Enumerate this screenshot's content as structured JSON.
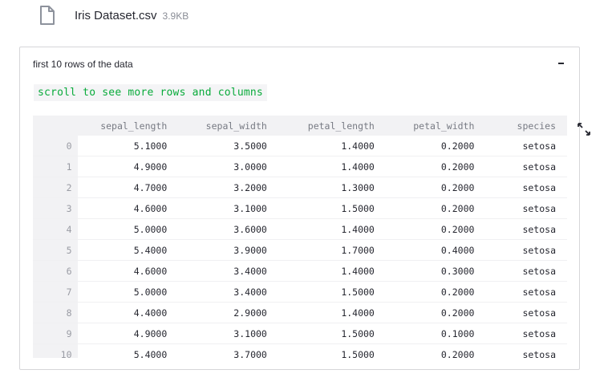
{
  "file": {
    "name": "Iris Dataset.csv",
    "size": "3.9KB",
    "icon": "file-icon"
  },
  "expander": {
    "header": "first 10 rows of the data",
    "collapse_icon": "minus-icon",
    "note": "scroll to see more rows and columns",
    "fullscreen_icon": "expand-icon"
  },
  "table": {
    "columns": [
      "",
      "sepal_length",
      "sepal_width",
      "petal_length",
      "petal_width",
      "species"
    ],
    "rows": [
      [
        "0",
        "5.1000",
        "3.5000",
        "1.4000",
        "0.2000",
        "setosa"
      ],
      [
        "1",
        "4.9000",
        "3.0000",
        "1.4000",
        "0.2000",
        "setosa"
      ],
      [
        "2",
        "4.7000",
        "3.2000",
        "1.3000",
        "0.2000",
        "setosa"
      ],
      [
        "3",
        "4.6000",
        "3.1000",
        "1.5000",
        "0.2000",
        "setosa"
      ],
      [
        "4",
        "5.0000",
        "3.6000",
        "1.4000",
        "0.2000",
        "setosa"
      ],
      [
        "5",
        "5.4000",
        "3.9000",
        "1.7000",
        "0.4000",
        "setosa"
      ],
      [
        "6",
        "4.6000",
        "3.4000",
        "1.4000",
        "0.3000",
        "setosa"
      ],
      [
        "7",
        "5.0000",
        "3.4000",
        "1.5000",
        "0.2000",
        "setosa"
      ],
      [
        "8",
        "4.4000",
        "2.9000",
        "1.4000",
        "0.2000",
        "setosa"
      ],
      [
        "9",
        "4.9000",
        "3.1000",
        "1.5000",
        "0.1000",
        "setosa"
      ],
      [
        "10",
        "5.4000",
        "3.7000",
        "1.5000",
        "0.2000",
        "setosa"
      ]
    ]
  }
}
